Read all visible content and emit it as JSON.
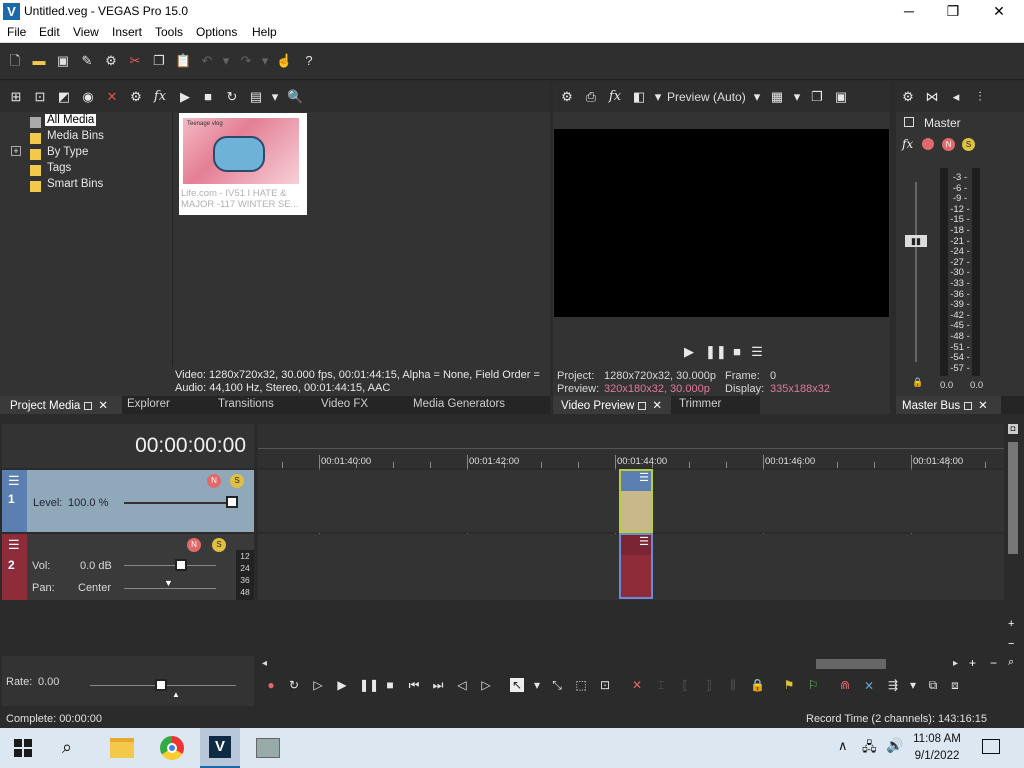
{
  "app": {
    "title": "Untitled.veg - VEGAS Pro 15.0",
    "logo": "V"
  },
  "window_controls": {
    "minimize": "─",
    "maximize": "❐",
    "close": "✕"
  },
  "menu": [
    "File",
    "Edit",
    "View",
    "Insert",
    "Tools",
    "Options",
    "Help"
  ],
  "project_media": {
    "tree": [
      "All Media",
      "Media Bins",
      "By Type",
      "Tags",
      "Smart Bins"
    ],
    "expander": "+",
    "thumbnail": {
      "title_text": "Teenage vlog",
      "caption": "Life.com - IV51 I HATE & MAJOR -117 WINTER SE..."
    },
    "info_video": "Video: 1280x720x32, 30.000 fps, 00:01:44:15, Alpha = None, Field Order =",
    "info_audio": "Audio: 44,100 Hz, Stereo, 00:01:44:15, AAC",
    "tabs": [
      "Project Media",
      "Explorer",
      "Transitions",
      "Video FX",
      "Media Generators"
    ]
  },
  "preview": {
    "mode": "Preview (Auto)",
    "project_label": "Project:",
    "project_value": "1280x720x32, 30.000p",
    "frame_label": "Frame:",
    "frame_value": "0",
    "preview_label": "Preview:",
    "preview_value": "320x180x32, 30.000p",
    "display_label": "Display:",
    "display_value": "335x188x32",
    "tabs": [
      "Video Preview",
      "Trimmer"
    ]
  },
  "master": {
    "label": "Master",
    "scale": [
      "3",
      "6",
      "9",
      "12",
      "15",
      "18",
      "21",
      "24",
      "27",
      "30",
      "33",
      "36",
      "39",
      "42",
      "45",
      "48",
      "51",
      "54",
      "57"
    ],
    "left_value": "0.0",
    "right_value": "0.0",
    "tab": "Master Bus"
  },
  "timeline": {
    "timecode": "00:00:00:00",
    "ruler": [
      "00:01:40:00",
      "00:01:42:00",
      "00:01:44:00",
      "00:01:46:00",
      "00:01:48:00"
    ],
    "track1": {
      "number": "1",
      "level_label": "Level:",
      "level_value": "100.0 %"
    },
    "track2": {
      "number": "2",
      "vol_label": "Vol:",
      "vol_value": "0.0 dB",
      "pan_label": "Pan:",
      "pan_value": "Center",
      "meter": [
        "12",
        "24",
        "36",
        "48"
      ]
    },
    "rate_label": "Rate:",
    "rate_value": "0.00"
  },
  "status": {
    "left": "Complete: 00:00:00",
    "right": "Record Time (2 channels): 143:16:15"
  },
  "taskbar": {
    "time": "11:08 AM",
    "date": "9/1/2022"
  },
  "colors": {
    "accent_blue": "#5b7fb0",
    "track1": "#8fa9bb",
    "track2": "#8e2c3a",
    "preview_info_pink": "#e07a9a"
  }
}
